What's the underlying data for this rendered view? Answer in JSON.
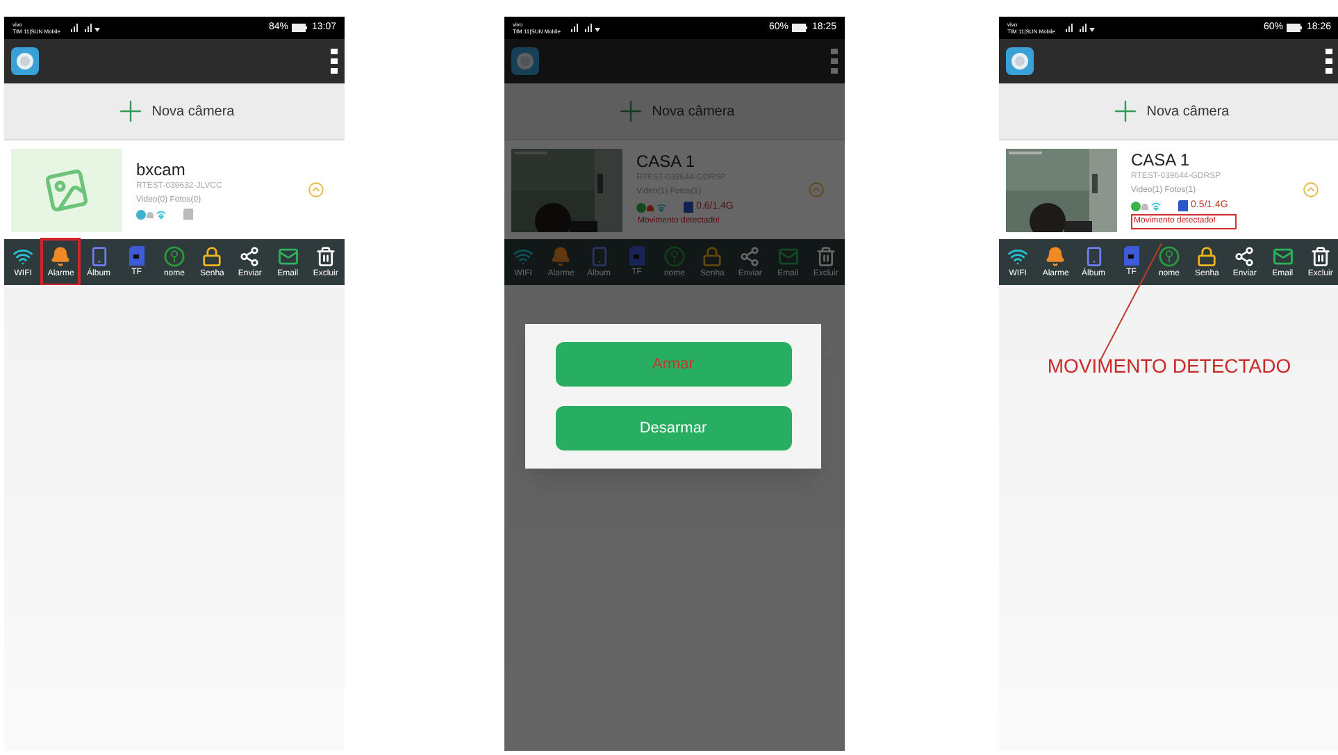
{
  "phones": [
    {
      "status_bar": {
        "carrier": "vivo",
        "network": "TIM 11|SUN Mobile",
        "battery": "84%",
        "time": "13:07"
      },
      "add_camera": "Nova câmera",
      "camera": {
        "name": "bxcam",
        "uid": "RTEST-039632-JLVCC",
        "counts": "Video(0) Fotos(0)",
        "thumbnail": {
          "kind": "placeholder"
        }
      },
      "toolbar": [
        {
          "label": "WIFI",
          "highlighted": false
        },
        {
          "label": "Alarme",
          "highlighted": true
        },
        {
          "label": "Álbum",
          "highlighted": false
        },
        {
          "label": "TF",
          "highlighted": false
        },
        {
          "label": "nome",
          "highlighted": false
        },
        {
          "label": "Senha",
          "highlighted": false
        },
        {
          "label": "Enviar",
          "highlighted": false
        },
        {
          "label": "Email",
          "highlighted": false
        },
        {
          "label": "Excluir",
          "highlighted": false
        }
      ],
      "dimmed": false
    },
    {
      "status_bar": {
        "carrier": "vivo",
        "network": "TIM 11|SUN Mobile",
        "battery": "60%",
        "time": "18:25"
      },
      "add_camera": "Nova câmera",
      "camera": {
        "name": "CASA 1",
        "uid": "RTEST-039644-GDRSP",
        "counts": "Video(1) Fotos(1)",
        "storage": "0.6/1.4G",
        "alert": "Movimento detectado!",
        "alert_boxed": false
      },
      "toolbar": [
        {
          "label": "WIFI",
          "highlighted": false
        },
        {
          "label": "Alarme",
          "highlighted": false
        },
        {
          "label": "Álbum",
          "highlighted": false
        },
        {
          "label": "TF",
          "highlighted": false
        },
        {
          "label": "nome",
          "highlighted": false
        },
        {
          "label": "Senha",
          "highlighted": false
        },
        {
          "label": "Enviar",
          "highlighted": false
        },
        {
          "label": "Email",
          "highlighted": false
        },
        {
          "label": "Excluir",
          "highlighted": false
        }
      ],
      "dimmed": true,
      "dialog": {
        "buttons": [
          {
            "label": "Armar",
            "emphasized": true
          },
          {
            "label": "Desarmar",
            "emphasized": false
          }
        ]
      }
    },
    {
      "status_bar": {
        "carrier": "vivo",
        "network": "TIM 11|SUN Mobile",
        "battery": "60%",
        "time": "18:26"
      },
      "add_camera": "Nova câmera",
      "camera": {
        "name": "CASA 1",
        "uid": "RTEST-039644-GDRSP",
        "counts": "Video(1) Fotos(1)",
        "storage": "0.5/1.4G",
        "alert": "Movimento detectado!",
        "alert_boxed": true
      },
      "toolbar": [
        {
          "label": "WIFI",
          "highlighted": false
        },
        {
          "label": "Alarme",
          "highlighted": false
        },
        {
          "label": "Álbum",
          "highlighted": false
        },
        {
          "label": "TF",
          "highlighted": false
        },
        {
          "label": "nome",
          "highlighted": false
        },
        {
          "label": "Senha",
          "highlighted": false
        },
        {
          "label": "Enviar",
          "highlighted": false
        },
        {
          "label": "Email",
          "highlighted": false
        },
        {
          "label": "Excluir",
          "highlighted": false
        }
      ],
      "dimmed": false,
      "annotation": "MOVIMENTO DETECTADO"
    }
  ]
}
